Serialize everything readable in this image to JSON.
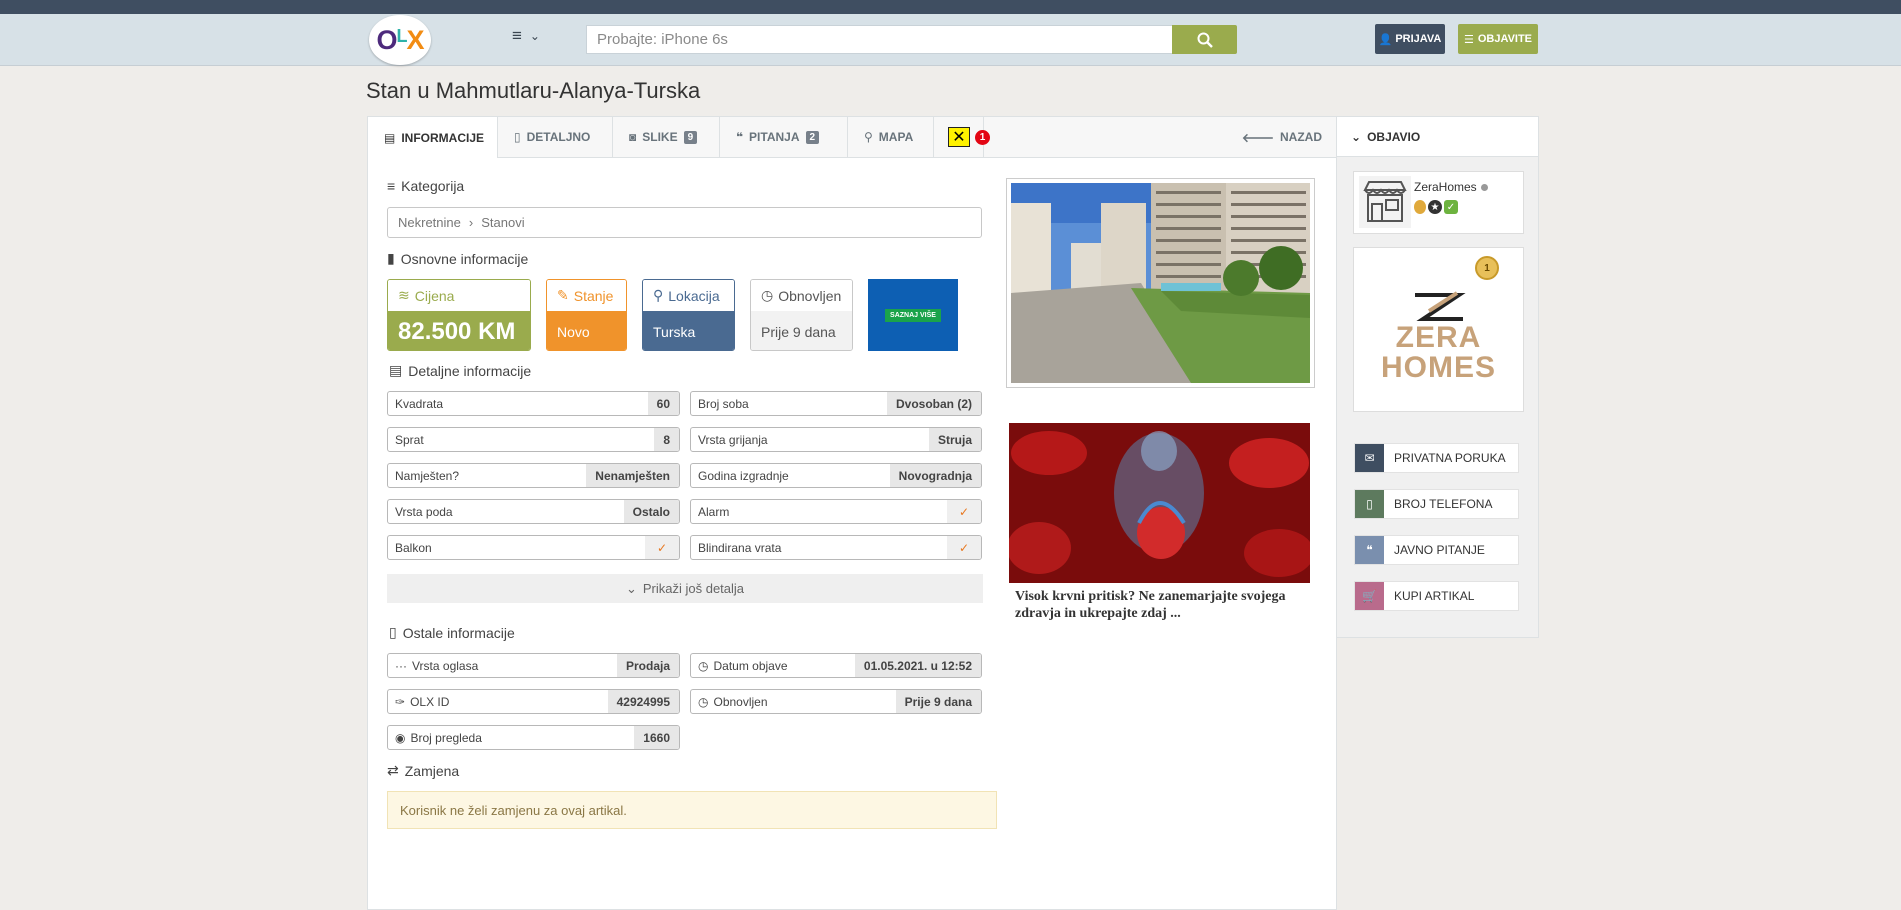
{
  "header": {
    "logo": "OLX",
    "search_placeholder": "Probajte: iPhone 6s",
    "login_label": "PRIJAVA",
    "post_label": "OBJAVITE"
  },
  "listing": {
    "title": "Stan u Mahmutlaru-Alanya-Turska"
  },
  "tabs": [
    {
      "label": "INFORMACIJE",
      "icon": "id-card-icon",
      "active": true
    },
    {
      "label": "DETALJNO",
      "icon": "document-icon"
    },
    {
      "label": "SLIKE",
      "icon": "camera-icon",
      "count": "9"
    },
    {
      "label": "PITANJA",
      "icon": "comments-icon",
      "count": "2"
    },
    {
      "label": "MAPA",
      "icon": "map-pin-icon"
    }
  ],
  "raiffeisen_badge": "1",
  "back_label": "NAZAD",
  "category": {
    "title": "Kategorija",
    "path": [
      "Nekretnine",
      "Stanovi"
    ]
  },
  "basic": {
    "title": "Osnovne informacije",
    "price_label": "Cijena",
    "price_value": "82.500 KM",
    "state_label": "Stanje",
    "state_value": "Novo",
    "location_label": "Lokacija",
    "location_value": "Turska",
    "renewed_label": "Obnovljen",
    "renewed_value": "Prije 9 dana",
    "ad_text": "SAZNAJ VIŠE"
  },
  "details": {
    "title": "Detaljne informacije",
    "left": [
      {
        "k": "Kvadrata",
        "v": "60"
      },
      {
        "k": "Sprat",
        "v": "8"
      },
      {
        "k": "Namješten?",
        "v": "Nenamješten"
      },
      {
        "k": "Vrsta poda",
        "v": "Ostalo"
      },
      {
        "k": "Balkon",
        "v": "✓"
      }
    ],
    "right": [
      {
        "k": "Broj soba",
        "v": "Dvosoban (2)"
      },
      {
        "k": "Vrsta grijanja",
        "v": "Struja"
      },
      {
        "k": "Godina izgradnje",
        "v": "Novogradnja"
      },
      {
        "k": "Alarm",
        "v": "✓"
      },
      {
        "k": "Blindirana vrata",
        "v": "✓"
      }
    ],
    "more_label": "Prikaži još detalja"
  },
  "other": {
    "title": "Ostale informacije",
    "ad_type_k": "Vrsta oglasa",
    "ad_type_v": "Prodaja",
    "date_k": "Datum objave",
    "date_v": "01.05.2021. u 12:52",
    "id_k": "OLX ID",
    "id_v": "42924995",
    "renewed_k": "Obnovljen",
    "renewed_v": "Prije 9 dana",
    "views_k": "Broj pregleda",
    "views_v": "1660"
  },
  "swap": {
    "title": "Zamjena",
    "text": "Korisnik ne želi zamjenu za ovaj artikal."
  },
  "ad": {
    "text": "Visok krvni pritisk? Ne zanemarjajte svojega zdravja in ukrepajte zdaj ..."
  },
  "sidebar": {
    "title": "OBJAVIO",
    "seller_name": "ZeraHomes",
    "logo_line1": "ZERA",
    "logo_line2": "HOMES",
    "medal": "1",
    "actions": [
      {
        "label": "PRIVATNA PORUKA",
        "color": "#3f4e61",
        "icon": "envelope-icon"
      },
      {
        "label": "BROJ TELEFONA",
        "color": "#5d7a5e",
        "icon": "phone-icon"
      },
      {
        "label": "JAVNO PITANJE",
        "color": "#7a8fae",
        "icon": "comments-icon"
      },
      {
        "label": "KUPI ARTIKAL",
        "color": "#b96b8c",
        "icon": "cart-icon"
      }
    ]
  },
  "colors": {
    "price": "#9aab4d",
    "state": "#f0932b",
    "location": "#4a6a91",
    "renewed": "#f2f2f2",
    "header_dark": "#3f4e61"
  }
}
